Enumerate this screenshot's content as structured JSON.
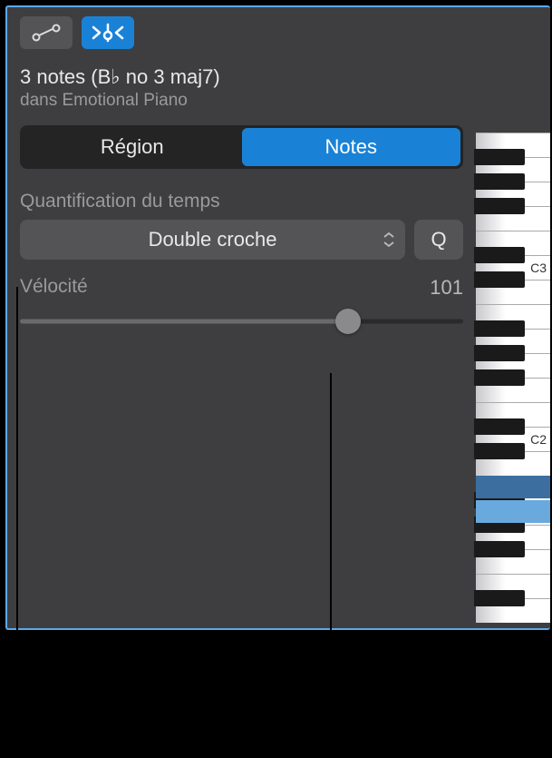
{
  "header": {
    "title": "3 notes (B♭ no 3 maj7)",
    "subtitle": "dans Emotional Piano"
  },
  "tabs": {
    "region": "Région",
    "notes": "Notes"
  },
  "quantize": {
    "label": "Quantification du temps",
    "value": "Double croche",
    "button": "Q"
  },
  "velocity": {
    "label": "Vélocité",
    "value": "101",
    "position": 74
  },
  "piano": {
    "labels": {
      "c3": "C3",
      "c2": "C2"
    }
  }
}
